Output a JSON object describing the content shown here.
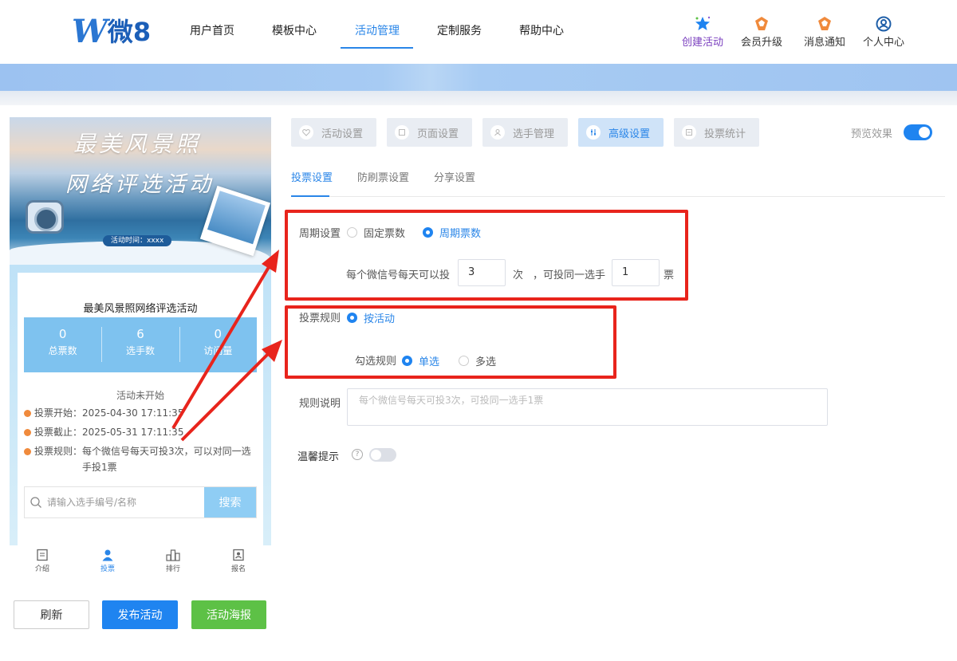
{
  "header": {
    "logo_text": "微8",
    "nav": [
      "用户首页",
      "模板中心",
      "活动管理",
      "定制服务",
      "帮助中心"
    ],
    "active_nav": "活动管理",
    "tools": [
      {
        "label": "创建活动",
        "icon": "star-icon"
      },
      {
        "label": "会员升级",
        "icon": "crown-icon"
      },
      {
        "label": "消息通知",
        "icon": "bell-icon"
      },
      {
        "label": "个人中心",
        "icon": "user-icon"
      }
    ]
  },
  "preview": {
    "poster_title_line1": "最美风景照",
    "poster_title_line2": "网络评选活动",
    "poster_time": "活动时间：xxxx",
    "title": "最美风景照网络评选活动",
    "stats": [
      {
        "value": "0",
        "label": "总票数"
      },
      {
        "value": "6",
        "label": "选手数"
      },
      {
        "value": "0",
        "label": "访问量"
      }
    ],
    "status": "活动未开始",
    "vote_start": "投票开始：2025-04-30 17:11:35",
    "vote_end": "投票截止：2025-05-31 17:11:35",
    "rule_label": "投票规则：",
    "rule_text": "每个微信号每天可投3次，可以对同一选手投1票",
    "search_placeholder": "请输入选手编号/名称",
    "search_button": "搜索",
    "tabbar": [
      "介绍",
      "投票",
      "排行",
      "报名"
    ],
    "active_tab": "投票"
  },
  "actions": {
    "refresh": "刷新",
    "publish": "发布活动",
    "poster": "活动海报"
  },
  "steps": [
    "活动设置",
    "页面设置",
    "选手管理",
    "高级设置",
    "投票统计"
  ],
  "active_step": "高级设置",
  "preview_toggle_label": "预览效果",
  "preview_toggle_on": true,
  "subtabs": [
    "投票设置",
    "防刷票设置",
    "分享设置"
  ],
  "active_subtab": "投票设置",
  "form": {
    "cycle_label": "周期设置",
    "cycle_options": [
      "固定票数",
      "周期票数"
    ],
    "cycle_selected": "周期票数",
    "per_day_prefix": "每个微信号每天可以投",
    "per_day_value": "3",
    "per_day_unit": "次",
    "same_player_prefix": "，可投同一选手",
    "same_player_value": "1",
    "same_player_unit": "票",
    "rule_label": "投票规则",
    "rule_option": "按活动",
    "select_rule_label": "勾选规则",
    "select_options": [
      "单选",
      "多选"
    ],
    "select_selected": "单选",
    "desc_label": "规则说明",
    "desc_placeholder": "每个微信号每天可投3次，可投同一选手1票",
    "tip_label": "温馨提示",
    "tip_help": "?",
    "tip_enabled": false
  },
  "annotation_color": "#e8241c"
}
